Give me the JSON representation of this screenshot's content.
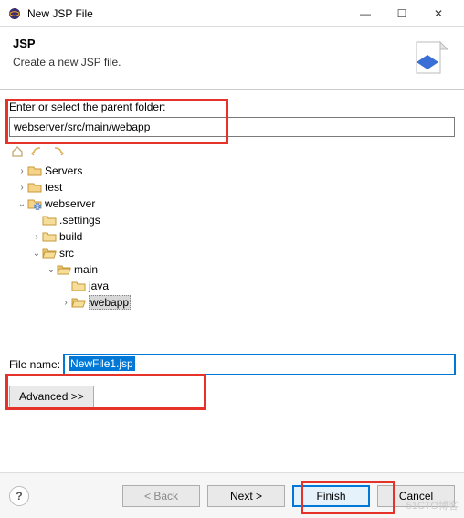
{
  "window": {
    "title": "New JSP File",
    "min": "—",
    "max": "☐",
    "close": "✕"
  },
  "header": {
    "title": "JSP",
    "subtitle": "Create a new JSP file."
  },
  "body": {
    "parent_label": "Enter or select the parent folder:",
    "parent_value": "webserver/src/main/webapp",
    "toolbar": {
      "home": "home-icon",
      "back": "back-arrow-icon",
      "forward": "forward-arrow-icon"
    }
  },
  "tree": [
    {
      "label": "Servers",
      "indent": 0,
      "expander": "›",
      "icon": "project"
    },
    {
      "label": "test",
      "indent": 0,
      "expander": "›",
      "icon": "project"
    },
    {
      "label": "webserver",
      "indent": 0,
      "expander": "⌄",
      "icon": "webproject"
    },
    {
      "label": ".settings",
      "indent": 1,
      "expander": "",
      "icon": "folder"
    },
    {
      "label": "build",
      "indent": 1,
      "expander": "›",
      "icon": "folder"
    },
    {
      "label": "src",
      "indent": 1,
      "expander": "⌄",
      "icon": "folder-open"
    },
    {
      "label": "main",
      "indent": 2,
      "expander": "⌄",
      "icon": "folder-open"
    },
    {
      "label": "java",
      "indent": 3,
      "expander": "",
      "icon": "folder"
    },
    {
      "label": "webapp",
      "indent": 3,
      "expander": "›",
      "icon": "folder-open",
      "selected": true
    }
  ],
  "filename": {
    "label": "File name:",
    "value": "NewFile1.jsp"
  },
  "advanced": {
    "label": "Advanced >>"
  },
  "buttons": {
    "help": "?",
    "back": "< Back",
    "next": "Next >",
    "finish": "Finish",
    "cancel": "Cancel"
  },
  "watermark": "51CTO博客"
}
